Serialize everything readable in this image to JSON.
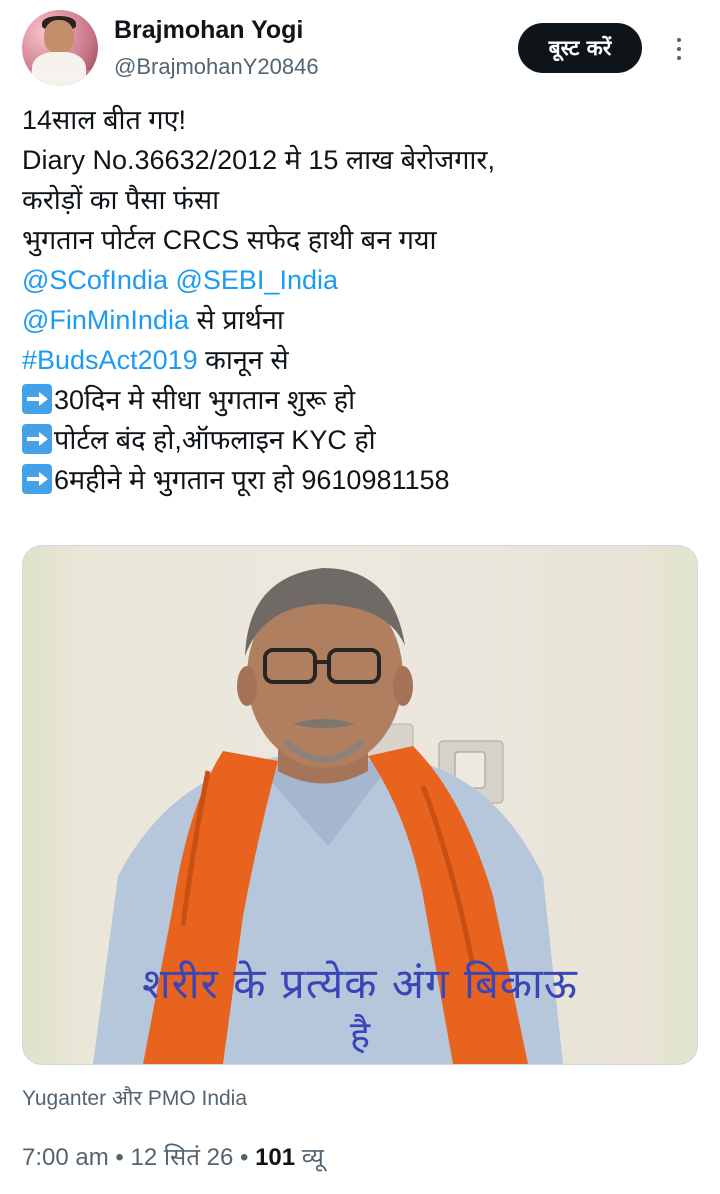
{
  "post": {
    "author_name": "Brajmohan Yogi",
    "author_handle": "@BrajmohanY20846",
    "boost_label": "बूस्ट करें",
    "lines": {
      "l1": "14साल बीत गए!",
      "l2": "Diary No.36632/2012 मे 15 लाख बेरोजगार,",
      "l3": "करोड़ों का पैसा फंसा",
      "l4": "भुगतान पोर्टल CRCS सफेद हाथी बन गया",
      "mention_sc": "@SCofIndia",
      "mention_sebi": "@SEBI_India",
      "mention_finmin": "@FinMinIndia",
      "l6_rest": " से प्रार्थना",
      "hashtag": "#BudsAct2019",
      "l7_rest": " कानून से",
      "b1": "30दिन मे सीधा भुगतान शुरू हो",
      "b2": "पोर्टल बंद हो,ऑफलाइन KYC हो",
      "b3": "6महीने मे भुगतान पूरा हो 9610981158"
    },
    "image": {
      "caption_line1": "शरीर के प्रत्येक अंग बिकाऊ",
      "caption_line2": "है"
    },
    "tagged": "Yuganter और PMO India",
    "time": "7:00 am",
    "separator": "•",
    "date": "12 सितं 26",
    "views_count": "101",
    "views_label": "व्यू"
  },
  "colors": {
    "link": "#1d9bf0",
    "secondary_text": "#536471",
    "caption": "#3a46b7",
    "scarf": "#e8641e"
  },
  "icons": [
    "more-options-icon",
    "arrow-right-icon"
  ]
}
